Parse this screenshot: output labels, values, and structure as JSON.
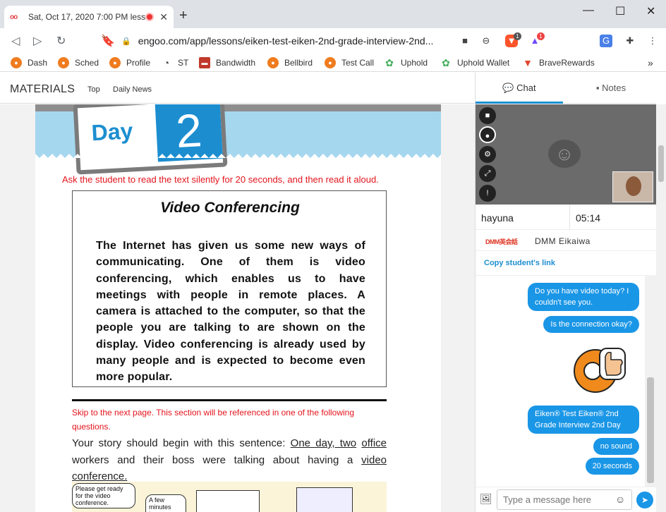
{
  "browser": {
    "tab_title": "Sat, Oct 17, 2020 7:00 PM lesso",
    "favicon": "oo",
    "new_tab": "+",
    "url": "engoo.com/app/lessons/eiken-test-eiken-2nd-grade-interview-2nd...",
    "ext_badge1": "1",
    "ext_badge2": "1"
  },
  "bookmarks": [
    {
      "label": "Dash",
      "icon": "fox-icon"
    },
    {
      "label": "Sched",
      "icon": "fox-icon"
    },
    {
      "label": "Profile",
      "icon": "fox-icon"
    },
    {
      "label": "ST",
      "icon": "speedometer-icon"
    },
    {
      "label": "Bandwidth",
      "icon": "bandwidth-icon"
    },
    {
      "label": "Bellbird",
      "icon": "fox-icon"
    },
    {
      "label": "Test Call",
      "icon": "fox-icon"
    },
    {
      "label": "Uphold",
      "icon": "uphold-icon"
    },
    {
      "label": "Uphold Wallet",
      "icon": "uphold-icon"
    },
    {
      "label": "BraveRewards",
      "icon": "brave-icon"
    }
  ],
  "materials": {
    "title": "MATERIALS",
    "links": [
      "Top",
      "Daily News"
    ]
  },
  "lesson": {
    "banner_day": "Day",
    "banner_number": "2",
    "instruction": "Ask the student to read the text silently for 20 seconds, and then read it aloud.",
    "passage_title": "Video Conferencing",
    "passage_body": "The Internet has given us some new ways of communicating. One of them is video conferencing, which enables us to have meetings with people in remote places. A camera is attached to the computer, so that the people you are talking to are shown on the display. Video conferencing is already used by many people and is expected to become even more popular.",
    "skip_note": "Skip to the next page.  This section will be referenced in one of the following questions.",
    "story_prefix": "Your story should begin with this sentence: ",
    "story_underlined_1": "One day, two",
    "story_underlined_2": "office",
    "story_rest": " workers and their boss were talking about having a ",
    "story_underlined_3": "video conference.",
    "comic_bubble_1": "Please get ready for the video conference.",
    "comic_bubble_2": "A few minutes later"
  },
  "side": {
    "tab_chat": "Chat",
    "tab_notes": "Notes",
    "student_name": "hayuna",
    "timer": "05:14",
    "dmm_logo": "DMM英会話",
    "dmm_name": "DMM Eikaiwa",
    "copy_link": "Copy student's link",
    "messages": [
      "Do you have video today? I couldn't see you.",
      "Is the connection okay?",
      "Eiken® Test Eiken® 2nd Grade Interview 2nd Day",
      "no sound",
      "20 seconds"
    ],
    "input_placeholder": "Type a message here"
  }
}
